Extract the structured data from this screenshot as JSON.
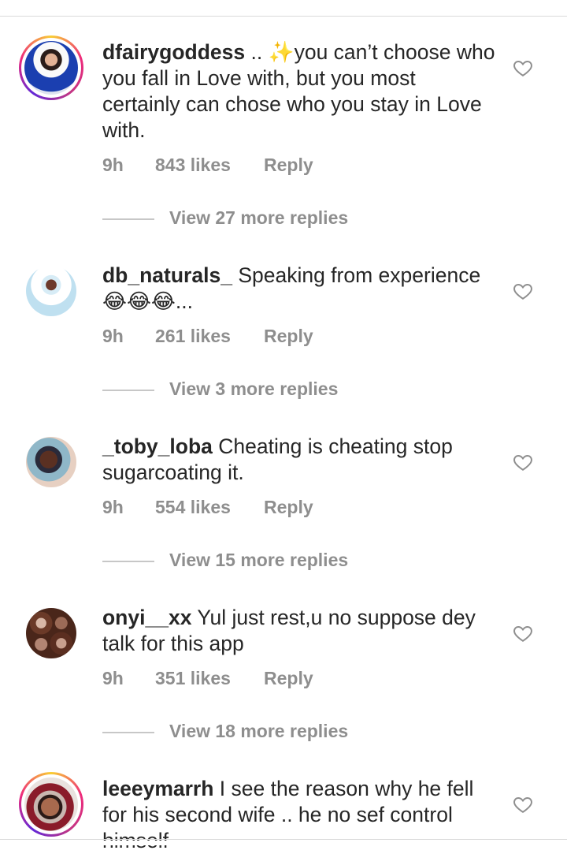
{
  "comments": [
    {
      "username": "dfairygoddess",
      "text": " .. ✨you can’t choose who you fall in Love with, but you most certainly can chose who you stay in Love with.",
      "time": "9h",
      "likes": "843 likes",
      "reply": "Reply",
      "view_replies": "View 27 more replies",
      "story_ring": true
    },
    {
      "username": "db_naturals_",
      "text": " Speaking from experience 😂😂😂...",
      "time": "9h",
      "likes": "261 likes",
      "reply": "Reply",
      "view_replies": "View 3 more replies",
      "story_ring": false
    },
    {
      "username": "_toby_loba",
      "text": " Cheating is cheating stop sugarcoating it.",
      "time": "9h",
      "likes": "554 likes",
      "reply": "Reply",
      "view_replies": "View 15 more replies",
      "story_ring": false
    },
    {
      "username": "onyi__xx",
      "text": " Yul just rest,u no suppose dey talk for this app",
      "time": "9h",
      "likes": "351 likes",
      "reply": "Reply",
      "view_replies": "View 18 more replies",
      "story_ring": false
    },
    {
      "username": "leeeymarrh",
      "text": " I see the reason why he fell for his second wife .. he no sef control himself",
      "story_ring": true
    }
  ],
  "icons": {
    "like": "heart-outline-icon"
  },
  "colors": {
    "text": "#262626",
    "secondary": "#8e8e8e",
    "divider": "#dbdbdb"
  }
}
